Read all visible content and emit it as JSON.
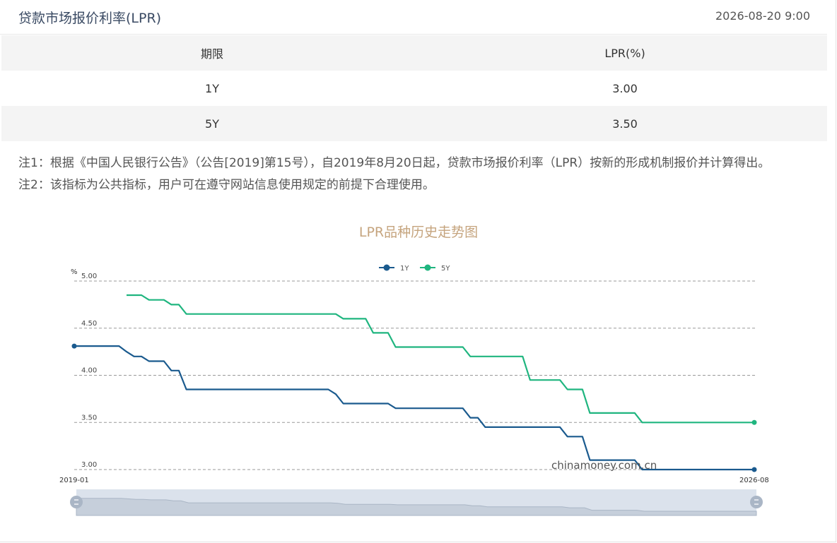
{
  "header": {
    "title": "贷款市场报价利率(LPR)",
    "timestamp": "2026-08-20 9:00"
  },
  "table": {
    "headers": [
      "期限",
      "LPR(%)"
    ],
    "rows": [
      [
        "1Y",
        "3.00"
      ],
      [
        "5Y",
        "3.50"
      ]
    ]
  },
  "notes": [
    "注1：根据《中国人民银行公告》（公告[2019]第15号），自2019年8月20日起，贷款市场报价利率（LPR）按新的形成机制报价并计算得出。",
    "注2：该指标为公共指标，用户可在遵守网站信息使用规定的前提下合理使用。"
  ],
  "watermark": "chinamoney.com.cn",
  "chart_data": {
    "type": "line",
    "title": "LPR品种历史走势图",
    "ylabel": "%",
    "ylim": [
      3.0,
      5.0
    ],
    "yticks": [
      "5.00",
      "4.50",
      "4.00",
      "3.50",
      "3.00"
    ],
    "x_start_label": "2019-01",
    "x_end_label": "2026-08",
    "grid": true,
    "legend_position": "top-center",
    "colors": {
      "1Y": "#1a5a8e",
      "5Y": "#1fb57f"
    },
    "series": [
      {
        "name": "1Y",
        "points": [
          [
            "2019-01",
            4.31
          ],
          [
            "2019-07",
            4.31
          ],
          [
            "2019-08",
            4.25
          ],
          [
            "2019-09",
            4.2
          ],
          [
            "2019-10",
            4.2
          ],
          [
            "2019-11",
            4.15
          ],
          [
            "2020-01",
            4.15
          ],
          [
            "2020-02",
            4.05
          ],
          [
            "2020-03",
            4.05
          ],
          [
            "2020-04",
            3.85
          ],
          [
            "2021-11",
            3.85
          ],
          [
            "2021-12",
            3.8
          ],
          [
            "2022-01",
            3.7
          ],
          [
            "2022-07",
            3.7
          ],
          [
            "2022-08",
            3.65
          ],
          [
            "2023-05",
            3.65
          ],
          [
            "2023-06",
            3.55
          ],
          [
            "2023-07",
            3.55
          ],
          [
            "2023-08",
            3.45
          ],
          [
            "2024-06",
            3.45
          ],
          [
            "2024-07",
            3.35
          ],
          [
            "2024-09",
            3.35
          ],
          [
            "2024-10",
            3.1
          ],
          [
            "2025-04",
            3.1
          ],
          [
            "2025-05",
            3.0
          ],
          [
            "2026-08",
            3.0
          ]
        ]
      },
      {
        "name": "5Y",
        "points": [
          [
            "2019-08",
            4.85
          ],
          [
            "2019-10",
            4.85
          ],
          [
            "2019-11",
            4.8
          ],
          [
            "2020-01",
            4.8
          ],
          [
            "2020-02",
            4.75
          ],
          [
            "2020-03",
            4.75
          ],
          [
            "2020-04",
            4.65
          ],
          [
            "2021-11",
            4.65
          ],
          [
            "2021-12",
            4.65
          ],
          [
            "2022-01",
            4.6
          ],
          [
            "2022-04",
            4.6
          ],
          [
            "2022-05",
            4.45
          ],
          [
            "2022-07",
            4.45
          ],
          [
            "2022-08",
            4.3
          ],
          [
            "2023-05",
            4.3
          ],
          [
            "2023-06",
            4.2
          ],
          [
            "2024-01",
            4.2
          ],
          [
            "2024-02",
            3.95
          ],
          [
            "2024-06",
            3.95
          ],
          [
            "2024-07",
            3.85
          ],
          [
            "2024-09",
            3.85
          ],
          [
            "2024-10",
            3.6
          ],
          [
            "2025-04",
            3.6
          ],
          [
            "2025-05",
            3.5
          ],
          [
            "2026-08",
            3.5
          ]
        ]
      }
    ]
  }
}
